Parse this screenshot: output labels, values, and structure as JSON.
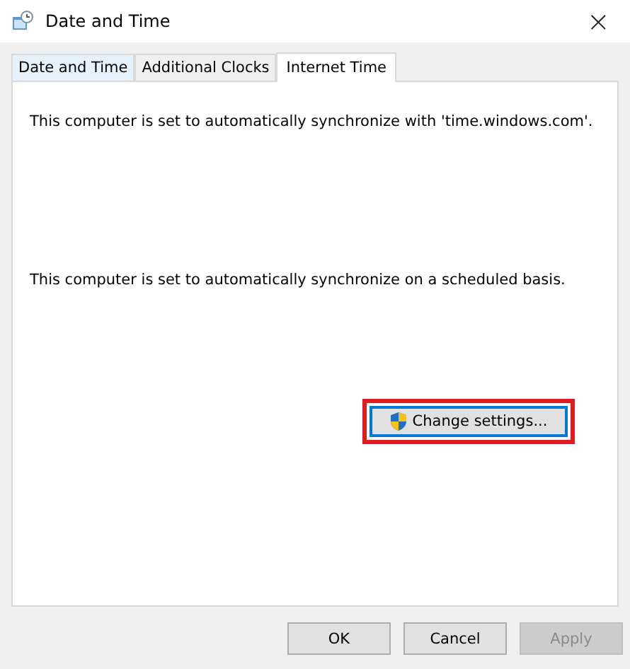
{
  "window": {
    "title": "Date and Time",
    "close": "×"
  },
  "tabs": [
    {
      "label": "Date and Time",
      "selected": false
    },
    {
      "label": "Additional Clocks",
      "selected": false
    },
    {
      "label": "Internet Time",
      "selected": true
    }
  ],
  "messages": [
    "This computer is set to automatically synchronize with 'time.windows.com'.",
    "This computer is set to automatically synchronize on a scheduled basis."
  ],
  "change_button": {
    "label": "Change settings...",
    "highlighted": true
  },
  "buttons": [
    {
      "label": "OK",
      "disabled": false
    },
    {
      "label": "Cancel",
      "disabled": false
    },
    {
      "label": "Apply",
      "disabled": true
    }
  ]
}
